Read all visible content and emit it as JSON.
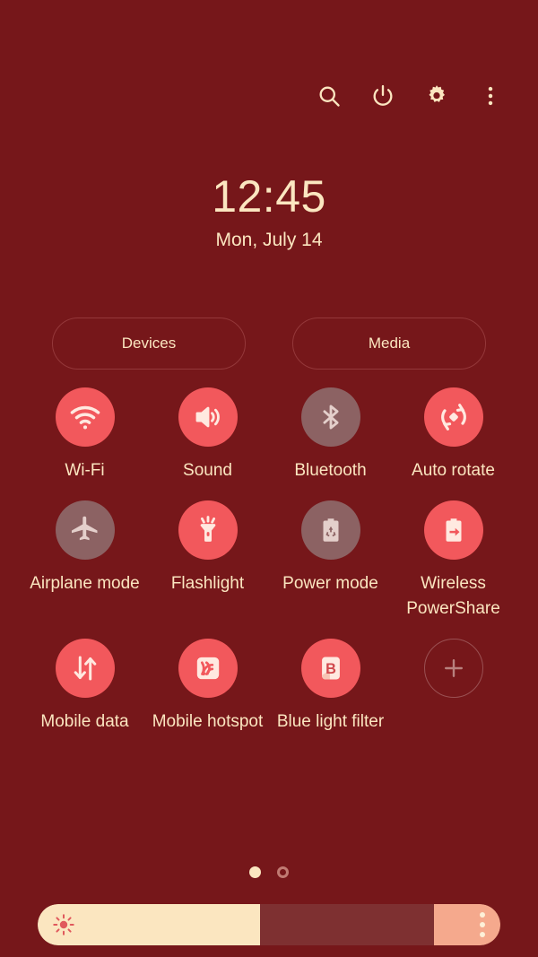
{
  "theme": {
    "background": "#76171a",
    "accent_on": "#f2585c",
    "accent_off": "#8c6263",
    "text": "#fbe6c0",
    "slider_fill": "#fbe6c0",
    "slider_track": "#7e3031",
    "slider_end": "#f5a98d"
  },
  "topbar": {
    "icons": [
      {
        "name": "search-icon",
        "label": "Search"
      },
      {
        "name": "power-icon",
        "label": "Power off"
      },
      {
        "name": "gear-icon",
        "label": "Settings"
      },
      {
        "name": "more-options-icon",
        "label": "More options"
      }
    ]
  },
  "clock": {
    "time": "12:45",
    "date": "Mon, July 14"
  },
  "pills": [
    {
      "label": "Devices"
    },
    {
      "label": "Media"
    }
  ],
  "tiles": [
    {
      "label": "Wi-Fi",
      "icon": "wifi-icon",
      "state": "on"
    },
    {
      "label": "Sound",
      "icon": "sound-icon",
      "state": "on"
    },
    {
      "label": "Bluetooth",
      "icon": "bluetooth-icon",
      "state": "off"
    },
    {
      "label": "Auto rotate",
      "icon": "auto-rotate-icon",
      "state": "on"
    },
    {
      "label": "Airplane mode",
      "icon": "airplane-icon",
      "state": "off"
    },
    {
      "label": "Flashlight",
      "icon": "flashlight-icon",
      "state": "on"
    },
    {
      "label": "Power mode",
      "icon": "power-mode-icon",
      "state": "off"
    },
    {
      "label": "Wireless PowerShare",
      "icon": "powershare-icon",
      "state": "on"
    },
    {
      "label": "Mobile data",
      "icon": "mobile-data-icon",
      "state": "on"
    },
    {
      "label": "Mobile hotspot",
      "icon": "mobile-hotspot-icon",
      "state": "on"
    },
    {
      "label": "Blue light filter",
      "icon": "blue-light-icon",
      "state": "on"
    },
    {
      "label": "",
      "icon": "add-icon",
      "state": "add"
    }
  ],
  "pagination": {
    "pages": 2,
    "current": 1
  },
  "brightness": {
    "value_percent": 48,
    "icon": "brightness-sun-icon",
    "menu_icon": "brightness-options-icon"
  }
}
